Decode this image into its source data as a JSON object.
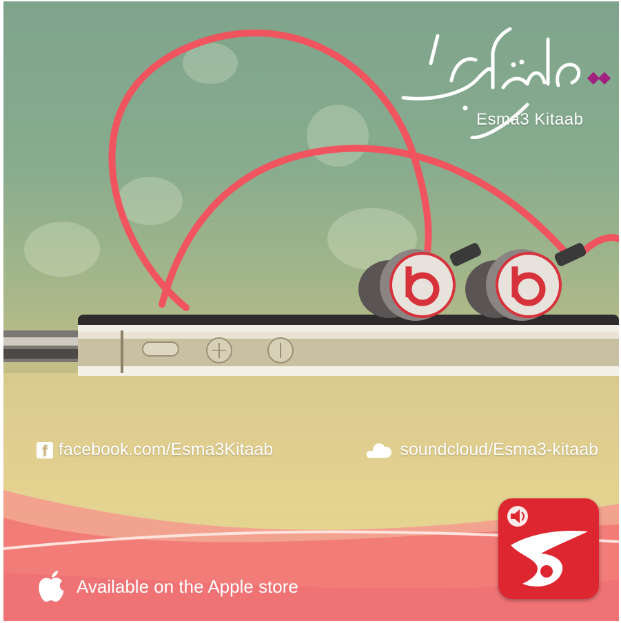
{
  "brand": {
    "arabic_name": "إسمع كتاب",
    "latin_name": "Esma3 Kitaab"
  },
  "social": {
    "facebook_icon_letter": "f",
    "facebook": "facebook.com/Esma3Kitaab",
    "soundcloud": "soundcloud/Esma3-kitaab"
  },
  "store": {
    "label": "Available on the Apple store"
  },
  "icons": {
    "facebook": "facebook-icon",
    "soundcloud": "soundcloud-icon",
    "apple": "apple-icon",
    "speaker": "speaker-icon",
    "app": "app-logo-icon"
  },
  "colors": {
    "accent_red": "#de2630",
    "cable_pink": "#f0545f",
    "wave_pink": "#f27c78",
    "brand_purple": "#a0217e"
  }
}
